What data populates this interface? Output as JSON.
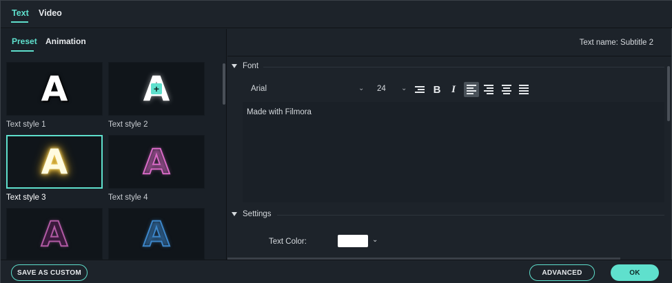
{
  "top_tabs": [
    "Text",
    "Video"
  ],
  "left": {
    "sub_tabs": [
      "Preset",
      "Animation"
    ],
    "styles": [
      {
        "label": "Text style 1",
        "glyph": "A"
      },
      {
        "label": "Text style 2",
        "glyph": "A"
      },
      {
        "label": "Text style 3",
        "glyph": "A"
      },
      {
        "label": "Text style 4",
        "glyph": "A"
      },
      {
        "label": "",
        "glyph": "A"
      },
      {
        "label": "",
        "glyph": "A"
      }
    ]
  },
  "right": {
    "text_name": "Text name: Subtitle 2",
    "font_section": "Font",
    "font_family": "Arial",
    "font_size": "24",
    "editor_text": "Made with Filmora",
    "settings_section": "Settings",
    "text_color_label": "Text Color:",
    "text_color": "#ffffff"
  },
  "bottom": {
    "save_custom": "SAVE AS CUSTOM",
    "advanced": "ADVANCED",
    "ok": "OK"
  },
  "colors": {
    "accent": "#5fe0cd",
    "background": "#1d232a"
  }
}
